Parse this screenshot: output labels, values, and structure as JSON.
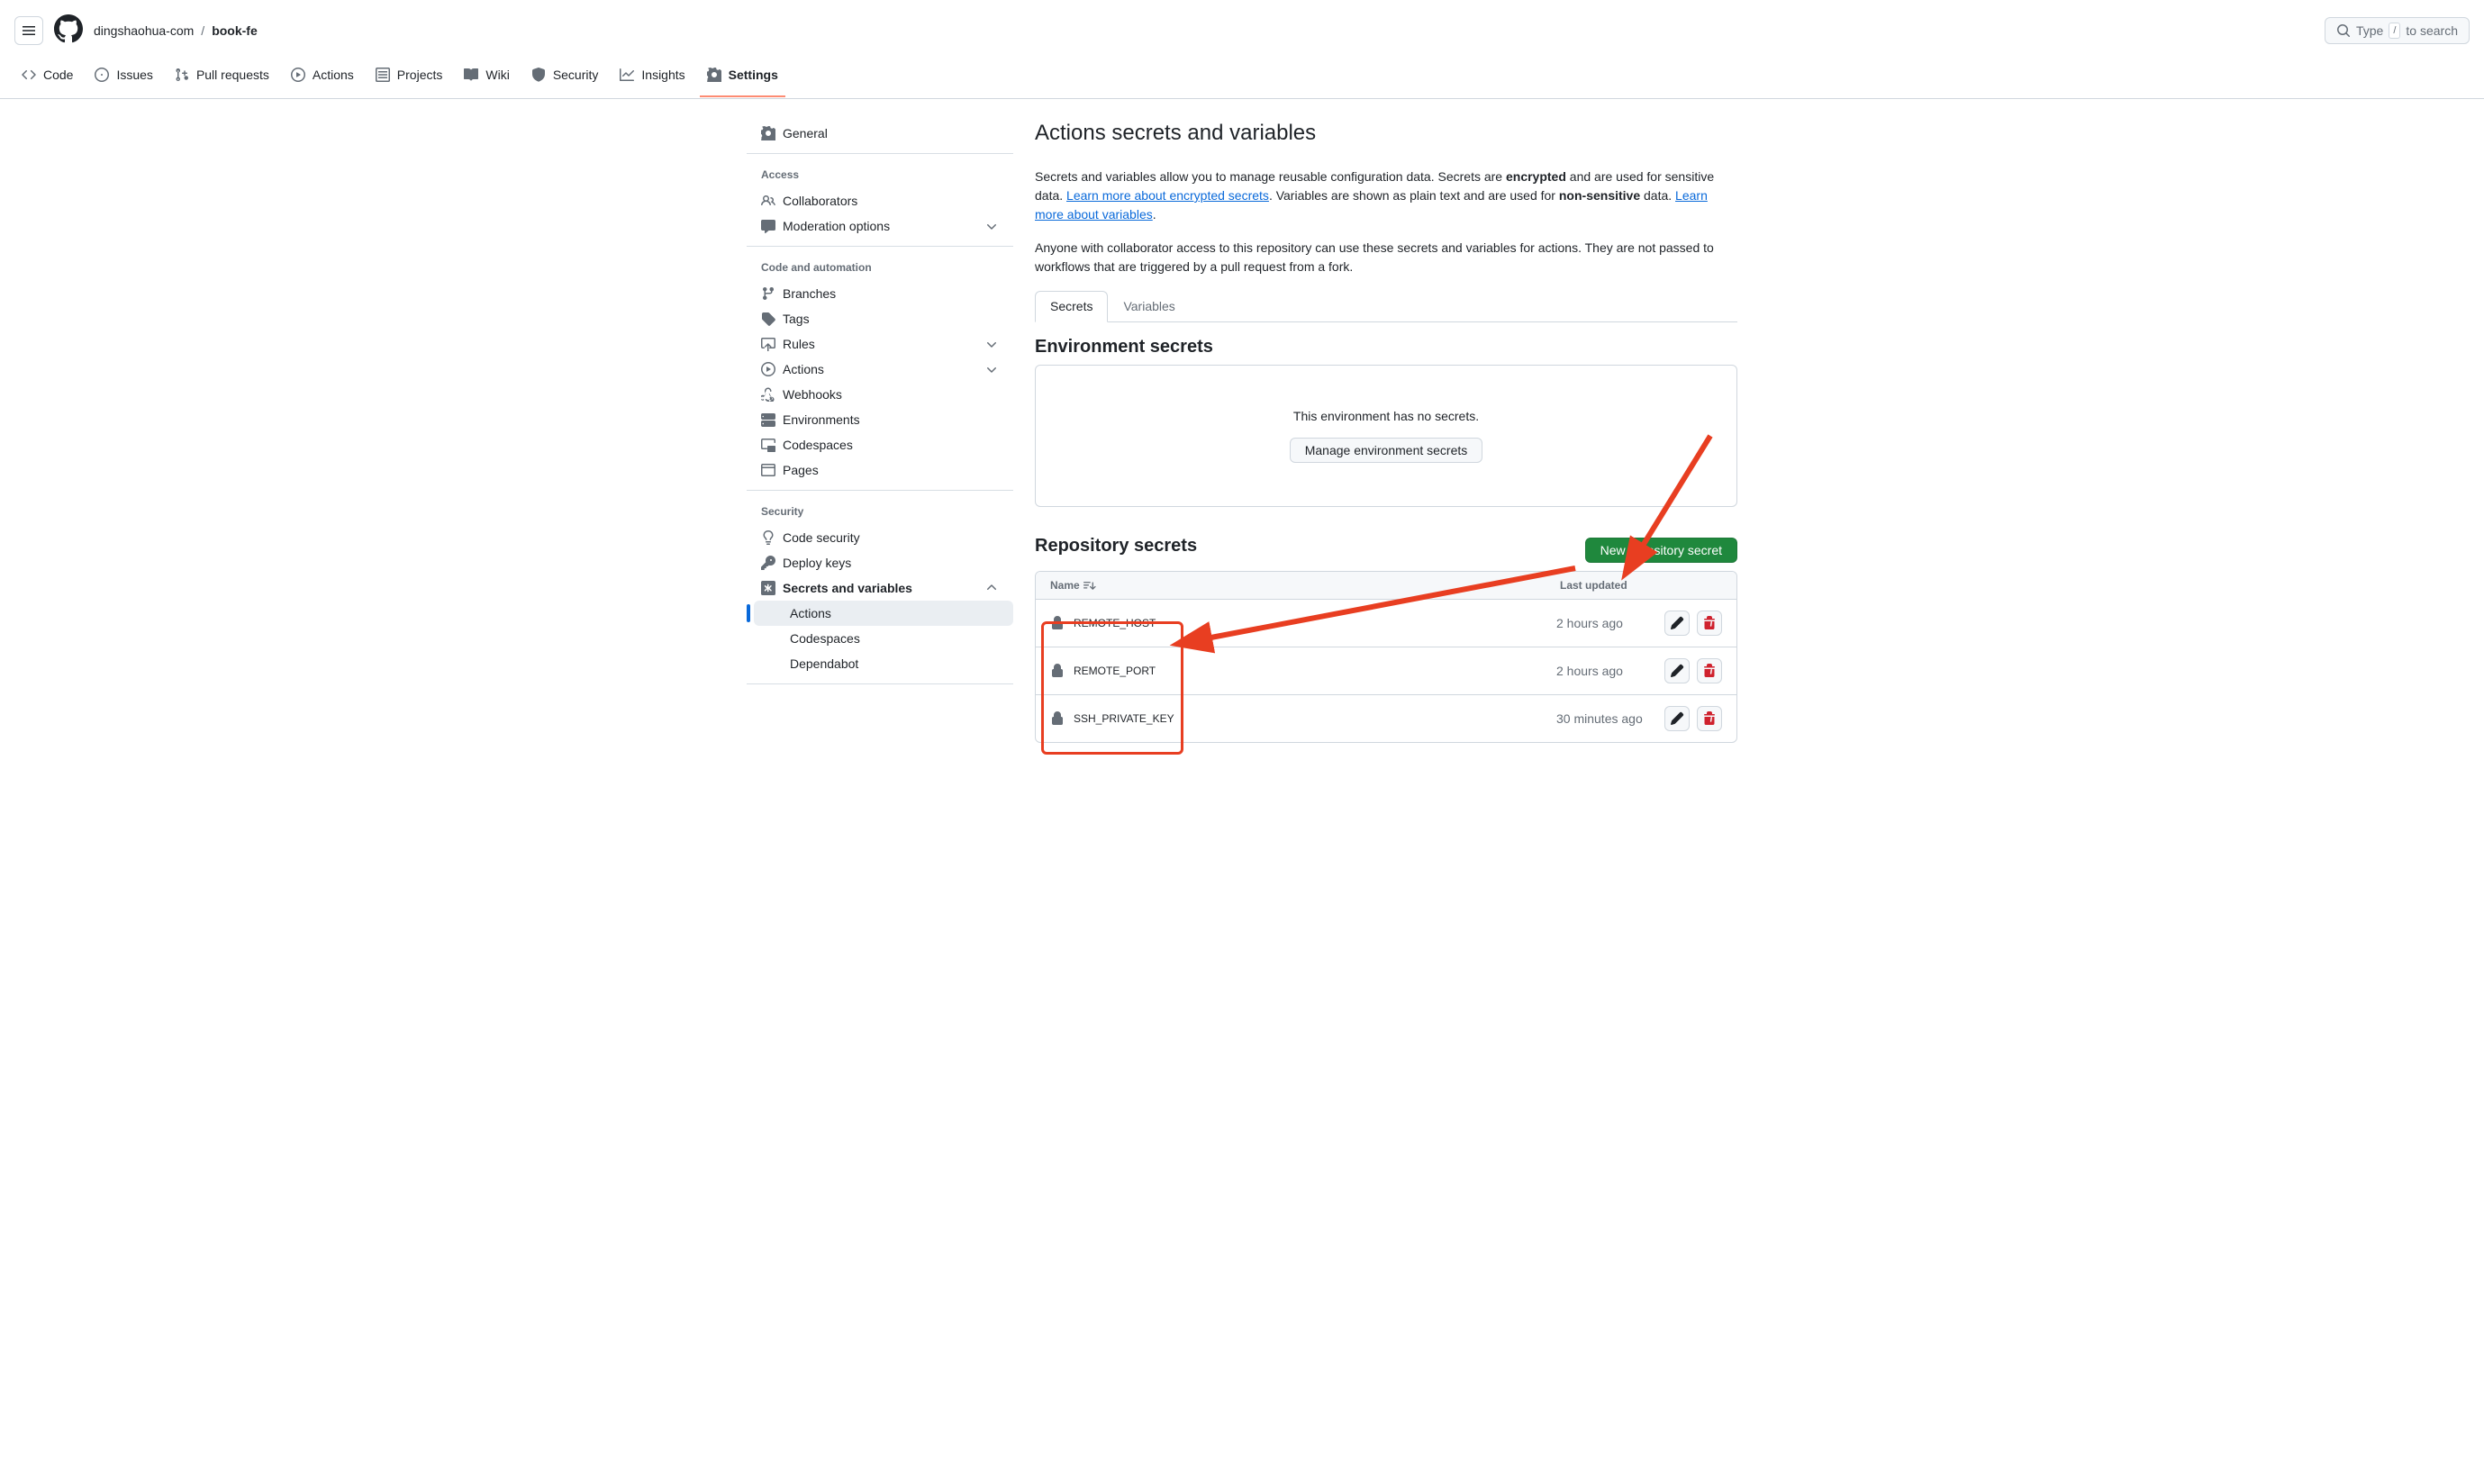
{
  "header": {
    "owner": "dingshaohua-com",
    "repo": "book-fe",
    "search_prefix": "Type",
    "search_key": "/",
    "search_suffix": "to search"
  },
  "repo_nav": {
    "code": "Code",
    "issues": "Issues",
    "pulls": "Pull requests",
    "actions": "Actions",
    "projects": "Projects",
    "wiki": "Wiki",
    "security": "Security",
    "insights": "Insights",
    "settings": "Settings"
  },
  "sidebar": {
    "general": "General",
    "access_title": "Access",
    "collaborators": "Collaborators",
    "moderation": "Moderation options",
    "automation_title": "Code and automation",
    "branches": "Branches",
    "tags": "Tags",
    "rules": "Rules",
    "actions": "Actions",
    "webhooks": "Webhooks",
    "environments": "Environments",
    "codespaces": "Codespaces",
    "pages": "Pages",
    "security_title": "Security",
    "code_security": "Code security",
    "deploy_keys": "Deploy keys",
    "secrets_vars": "Secrets and variables",
    "sub_actions": "Actions",
    "sub_codespaces": "Codespaces",
    "sub_dependabot": "Dependabot"
  },
  "page": {
    "title": "Actions secrets and variables",
    "desc1_a": "Secrets and variables allow you to manage reusable configuration data. Secrets are ",
    "desc1_b": "encrypted",
    "desc1_c": " and are used for sensitive data. ",
    "link1": "Learn more about encrypted secrets",
    "desc1_d": ". Variables are shown as plain text and are used for ",
    "desc1_e": "non-sensitive",
    "desc1_f": " data. ",
    "link2": "Learn more about variables",
    "desc1_g": ".",
    "desc2": "Anyone with collaborator access to this repository can use these secrets and variables for actions. They are not passed to workflows that are triggered by a pull request from a fork.",
    "tab_secrets": "Secrets",
    "tab_variables": "Variables",
    "env_title": "Environment secrets",
    "env_empty": "This environment has no secrets.",
    "env_btn": "Manage environment secrets",
    "repo_title": "Repository secrets",
    "new_btn": "New repository secret",
    "col_name": "Name",
    "col_updated": "Last updated",
    "secrets": [
      {
        "name": "REMOTE_HOST",
        "updated": "2 hours ago"
      },
      {
        "name": "REMOTE_PORT",
        "updated": "2 hours ago"
      },
      {
        "name": "SSH_PRIVATE_KEY",
        "updated": "30 minutes ago"
      }
    ]
  }
}
